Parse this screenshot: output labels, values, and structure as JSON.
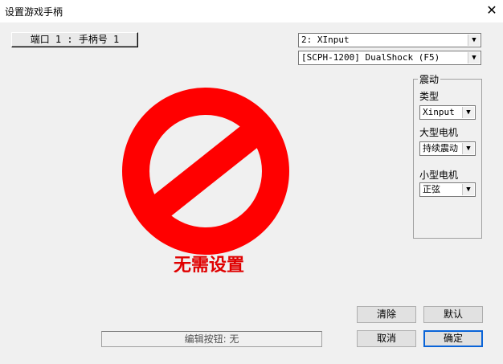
{
  "window": {
    "title": "设置游戏手柄",
    "close_glyph": "✕"
  },
  "port": {
    "label": "端口 1 : 手柄号 1"
  },
  "controller": {
    "api_value": "2: XInput",
    "type_value": "[SCPH-1200] DualShock (F5)"
  },
  "vibration": {
    "group_title": "震动",
    "type_label": "类型",
    "type_value": "Xinput",
    "large_motor_label": "大型电机",
    "large_motor_value": "持续震动",
    "small_motor_label": "小型电机",
    "small_motor_value": "正弦"
  },
  "no_settings": {
    "text": "无需设置",
    "icon": "prohibited-icon",
    "color": "#ff0000"
  },
  "status": {
    "text": "编辑按钮: 无"
  },
  "buttons": {
    "clear": "清除",
    "default": "默认",
    "cancel": "取消",
    "ok": "确定"
  }
}
